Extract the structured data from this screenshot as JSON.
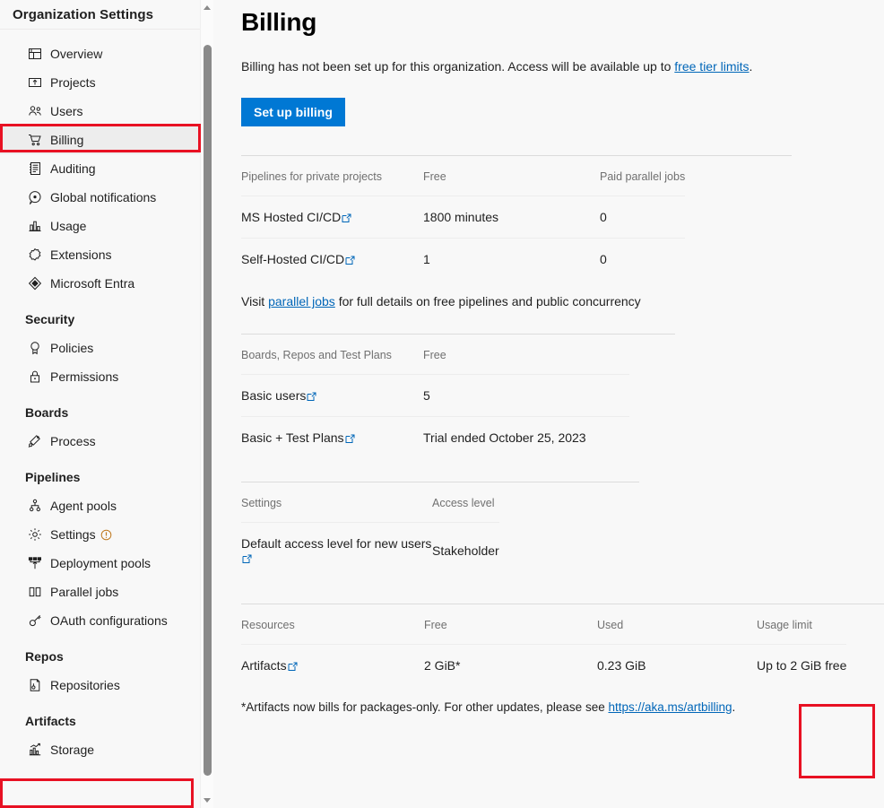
{
  "sidebar": {
    "header": "Organization Settings",
    "groups": [
      {
        "title": null,
        "items": [
          {
            "label": "Overview",
            "icon": "overview-icon"
          },
          {
            "label": "Projects",
            "icon": "projects-icon"
          },
          {
            "label": "Users",
            "icon": "users-icon"
          },
          {
            "label": "Billing",
            "icon": "billing-cart-icon",
            "selected": true,
            "highlighted": true
          },
          {
            "label": "Auditing",
            "icon": "auditing-icon"
          },
          {
            "label": "Global notifications",
            "icon": "notifications-icon"
          },
          {
            "label": "Usage",
            "icon": "usage-chart-icon"
          },
          {
            "label": "Extensions",
            "icon": "extensions-icon"
          },
          {
            "label": "Microsoft Entra",
            "icon": "microsoft-entra-icon"
          }
        ]
      },
      {
        "title": "Security",
        "items": [
          {
            "label": "Policies",
            "icon": "policies-icon"
          },
          {
            "label": "Permissions",
            "icon": "permissions-lock-icon"
          }
        ]
      },
      {
        "title": "Boards",
        "items": [
          {
            "label": "Process",
            "icon": "process-icon"
          }
        ]
      },
      {
        "title": "Pipelines",
        "items": [
          {
            "label": "Agent pools",
            "icon": "agent-pools-icon"
          },
          {
            "label": "Settings",
            "icon": "settings-gear-icon",
            "badge": "warning-shield-icon"
          },
          {
            "label": "Deployment pools",
            "icon": "deployment-pools-icon"
          },
          {
            "label": "Parallel jobs",
            "icon": "parallel-jobs-icon"
          },
          {
            "label": "OAuth configurations",
            "icon": "oauth-key-icon"
          }
        ]
      },
      {
        "title": "Repos",
        "items": [
          {
            "label": "Repositories",
            "icon": "repositories-icon"
          }
        ]
      },
      {
        "title": "Artifacts",
        "items": [
          {
            "label": "Storage",
            "icon": "storage-chart-icon",
            "highlighted": true
          }
        ]
      }
    ]
  },
  "main": {
    "title": "Billing",
    "intro_prefix": "Billing has not been set up for this organization. Access will be available up to ",
    "intro_link": "free tier limits",
    "intro_suffix": ".",
    "setup_button": "Set up billing",
    "pipelines_table": {
      "headers": [
        "Pipelines for private projects",
        "Free",
        "Paid parallel jobs"
      ],
      "rows": [
        {
          "name": "MS Hosted CI/CD",
          "external": true,
          "free": "1800 minutes",
          "paid": "0"
        },
        {
          "name": "Self-Hosted CI/CD",
          "external": true,
          "free": "1",
          "paid": "0"
        }
      ],
      "footnote_prefix": "Visit ",
      "footnote_link": "parallel jobs",
      "footnote_suffix": " for full details on free pipelines and public concurrency"
    },
    "boards_table": {
      "headers": [
        "Boards, Repos and Test Plans",
        "Free"
      ],
      "rows": [
        {
          "name": "Basic users",
          "external": true,
          "free": "5"
        },
        {
          "name": "Basic + Test Plans",
          "external": true,
          "free": "Trial ended October 25, 2023"
        }
      ]
    },
    "settings_table": {
      "headers": [
        "Settings",
        "Access level"
      ],
      "rows": [
        {
          "name": "Default access level for new users",
          "external": true,
          "value": "Stakeholder"
        }
      ]
    },
    "resources_table": {
      "headers": [
        "Resources",
        "Free",
        "Used",
        "Usage limit"
      ],
      "rows": [
        {
          "name": "Artifacts",
          "external": true,
          "free": "2 GiB*",
          "used": "0.23 GiB",
          "limit": "Up to 2 GiB free"
        }
      ],
      "footnote_prefix": "*Artifacts now bills for packages-only. For other updates, please see ",
      "footnote_link": "https://aka.ms/artbilling",
      "footnote_suffix": "."
    }
  },
  "colors": {
    "accent": "#0078d4",
    "link": "#0066b8",
    "highlight": "#e81123",
    "page_bg": "#f8f8f8",
    "selected_nav": "#ededed"
  },
  "scrollbar": {
    "up_arrow": "scroll-up-arrow",
    "down_arrow": "scroll-down-arrow"
  }
}
